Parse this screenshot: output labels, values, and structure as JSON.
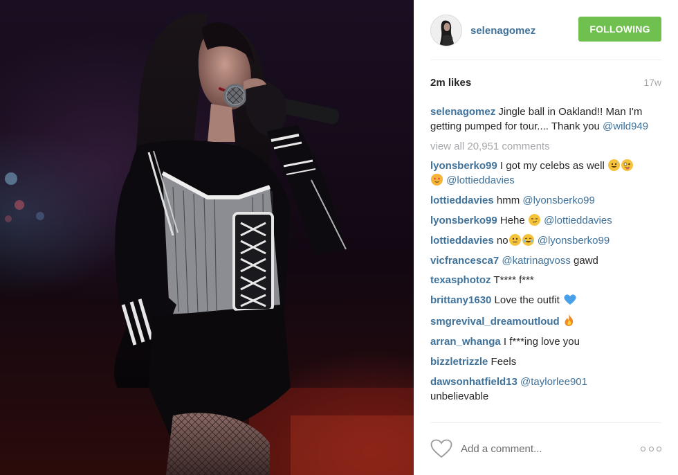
{
  "post": {
    "photo_icon": "concert-photo",
    "username": "selenagomez",
    "follow_label": "FOLLOWING",
    "likes": "2m likes",
    "time": "17w",
    "caption": {
      "user": "selenagomez",
      "text": " Jingle ball in Oakland!! Man I'm getting pumped for tour.... Thank you ",
      "mention": "@wild949"
    },
    "view_all": "view all 20,951 comments",
    "comments": [
      {
        "user": "lyonsberko99",
        "pre": " I got my celebs as well ",
        "emojis_mid": [
          "grinning-sweat-emoji",
          "winking-tongue-emoji",
          "heart-eyes-cat-emoji"
        ],
        "mention": "@lottieddavies",
        "post": ""
      },
      {
        "user": "lottieddavies",
        "pre": " hmm ",
        "mention": "@lyonsberko99",
        "post": ""
      },
      {
        "user": "lyonsberko99",
        "pre": " Hehe ",
        "emoji_before_mention": "smirk-emoji",
        "mention": "@lottieddavies",
        "post": ""
      },
      {
        "user": "lottieddavies",
        "pre": " no",
        "emoji_before_mention": "neutral-tears-emoji",
        "mention": "@lyonsberko99",
        "post": ""
      },
      {
        "user": "vicfrancesca7",
        "pre": " ",
        "mention": "@katrinagvoss",
        "post": " gawd"
      },
      {
        "user": "texasphotoz",
        "pre": " T**** f***",
        "mention": "",
        "post": ""
      },
      {
        "user": "brittany1630",
        "pre": " Love the outfit ",
        "emoji_after": "blue-heart-emoji",
        "mention": "",
        "post": ""
      },
      {
        "user": "smgrevival_dreamoutloud",
        "pre": " ",
        "emoji_after": "fire-emoji",
        "mention": "",
        "post": ""
      },
      {
        "user": "arran_whanga",
        "pre": " I f***ing love you",
        "mention": "",
        "post": ""
      },
      {
        "user": "bizzletrizzle",
        "pre": " Feels",
        "mention": "",
        "post": ""
      },
      {
        "user": "dawsonhatfield13",
        "pre": " ",
        "mention": "@taylorlee901",
        "post": " unbelievable"
      }
    ],
    "add_comment_placeholder": "Add a comment...",
    "like_icon": "heart-outline-icon",
    "more_icon": "more-options-icon"
  },
  "colors": {
    "link": "#3f729b",
    "follow_bg": "#70c050",
    "muted": "#a5a7aa",
    "text": "#262626"
  }
}
